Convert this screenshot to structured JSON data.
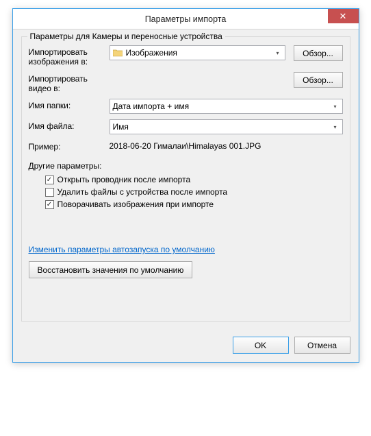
{
  "window": {
    "title": "Параметры импорта",
    "close_label": "✕"
  },
  "group": {
    "title": "Параметры для Камеры и переносные устройства"
  },
  "rows": {
    "import_images_label": "Импортировать изображения в:",
    "import_images_value": "Изображения",
    "import_videos_label": "Импортировать видео в:",
    "folder_name_label": "Имя папки:",
    "folder_name_value": "Дата импорта + имя",
    "file_name_label": "Имя файла:",
    "file_name_value": "Имя",
    "example_label": "Пример:",
    "example_value": "2018-06-20 Гималаи\\Himalayas 001.JPG",
    "browse_label": "Обзор..."
  },
  "other": {
    "title": "Другие параметры:",
    "opt1": "Открыть проводник после импорта",
    "opt1_checked": true,
    "opt2": "Удалить файлы с устройства после импорта",
    "opt2_checked": false,
    "opt3": "Поворачивать изображения при импорте",
    "opt3_checked": true
  },
  "link": {
    "text": "Изменить параметры автозапуска по умолчанию"
  },
  "restore": {
    "text": "Восстановить значения по умолчанию"
  },
  "buttons": {
    "ok": "OK",
    "cancel": "Отмена"
  },
  "checkmark": "✓"
}
